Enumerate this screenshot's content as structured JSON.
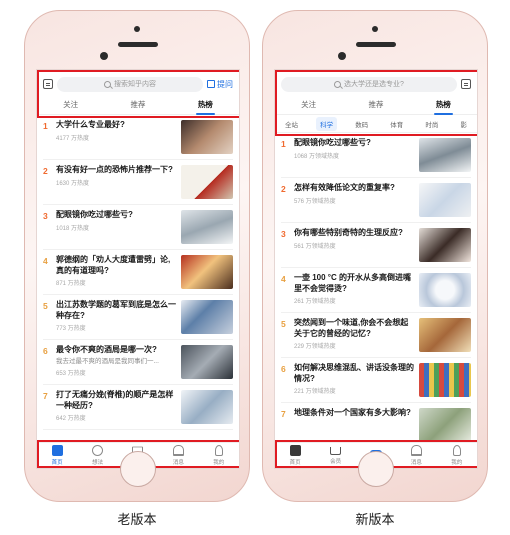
{
  "old_version": {
    "caption": "老版本",
    "search_placeholder": "搜索知乎内容",
    "ask_label": "提问",
    "tabs": [
      {
        "label": "关注",
        "active": false
      },
      {
        "label": "推荐",
        "active": false
      },
      {
        "label": "热榜",
        "active": true
      }
    ],
    "items": [
      {
        "rank": "1",
        "title": "大学什么专业最好?",
        "sub": "",
        "heat": "4177 万热度"
      },
      {
        "rank": "2",
        "title": "有没有好一点的恐怖片推荐一下?",
        "sub": "",
        "heat": "1630 万热度"
      },
      {
        "rank": "3",
        "title": "配眼镜你吃过哪些亏?",
        "sub": "",
        "heat": "1018 万热度"
      },
      {
        "rank": "4",
        "title": "郭德纲的「劝人大度遭雷劈」论,真的有道理吗?",
        "sub": "",
        "heat": "871 万热度"
      },
      {
        "rank": "5",
        "title": "出江苏数学题的葛军到底是怎么一种存在?",
        "sub": "",
        "heat": "773 万热度"
      },
      {
        "rank": "6",
        "title": "最令你不爽的酒局是哪一次?",
        "sub": "我去过最不爽的酒局是我同事们一...",
        "heat": "653 万热度"
      },
      {
        "rank": "7",
        "title": "打了无痛分娩(脊椎)的顺产是怎样一种经历?",
        "sub": "",
        "heat": "642 万热度"
      }
    ],
    "nav": [
      {
        "label": "首页",
        "icon": "home-icon",
        "active": true
      },
      {
        "label": "想法",
        "icon": "idea-icon",
        "active": false
      },
      {
        "label": "大学",
        "icon": "graduation-cap-icon",
        "active": false
      },
      {
        "label": "消息",
        "icon": "bell-icon",
        "active": false
      },
      {
        "label": "我的",
        "icon": "person-icon",
        "active": false
      }
    ]
  },
  "new_version": {
    "caption": "新版本",
    "search_placeholder": "选大学还是选专业?",
    "tabs": [
      {
        "label": "关注",
        "active": false
      },
      {
        "label": "推荐",
        "active": false
      },
      {
        "label": "热榜",
        "active": true
      }
    ],
    "subtabs": [
      {
        "label": "全站",
        "active": false
      },
      {
        "label": "科学",
        "active": true
      },
      {
        "label": "数码",
        "active": false
      },
      {
        "label": "体育",
        "active": false
      },
      {
        "label": "时尚",
        "active": false
      },
      {
        "label": "影",
        "active": false
      }
    ],
    "items": [
      {
        "rank": "1",
        "title": "配眼镜你吃过哪些亏?",
        "heat": "1068 万领域热度"
      },
      {
        "rank": "2",
        "title": "怎样有效降低论文的重复率?",
        "heat": "576 万领域热度"
      },
      {
        "rank": "3",
        "title": "你有哪些特别奇特的生理反应?",
        "heat": "561 万领域热度"
      },
      {
        "rank": "4",
        "title": "一壶 100 °C 的开水从多高倒进嘴里不会觉得烫?",
        "heat": "261 万领域热度"
      },
      {
        "rank": "5",
        "title": "突然闻到一个味道,你会不会想起关于它的曾经的记忆?",
        "heat": "229 万领域热度"
      },
      {
        "rank": "6",
        "title": "如何解决思维混乱、讲话没条理的情况?",
        "heat": "221 万领域热度"
      },
      {
        "rank": "7",
        "title": "地理条件对一个国家有多大影响?",
        "heat": ""
      }
    ],
    "nav": [
      {
        "label": "首页",
        "icon": "home-icon",
        "active": false
      },
      {
        "label": "会员",
        "icon": "crown-icon",
        "active": false
      },
      {
        "label": "",
        "icon": "plus-icon",
        "active": false
      },
      {
        "label": "消息",
        "icon": "bell-icon",
        "active": false
      },
      {
        "label": "我的",
        "icon": "person-icon",
        "active": false
      }
    ]
  },
  "colors": {
    "accent": "#1f6fe0",
    "highlight_border": "#e01b22",
    "rank": "#f06a2f"
  }
}
